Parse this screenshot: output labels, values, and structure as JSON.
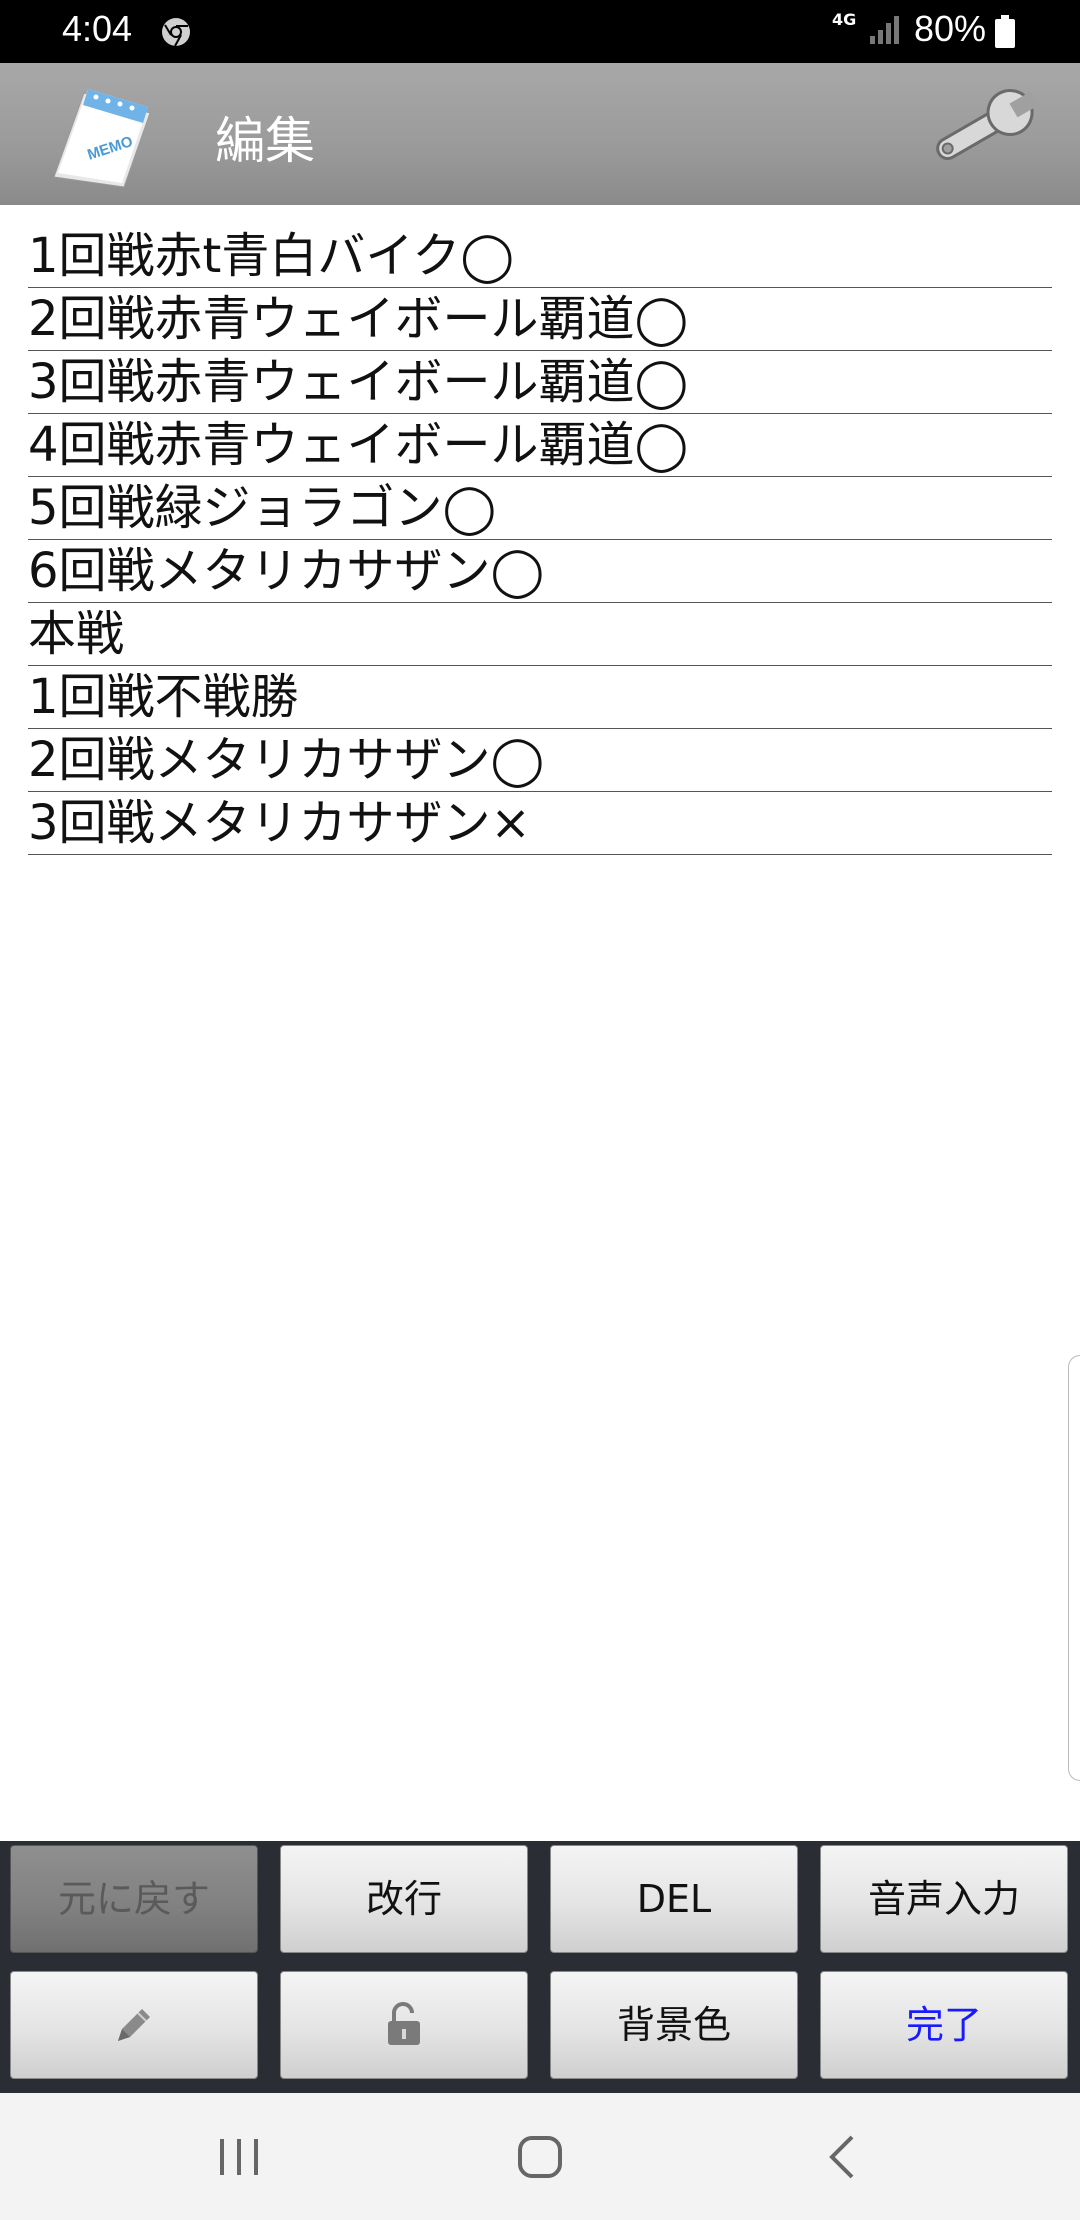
{
  "status_bar": {
    "time": "4:04",
    "network": "4G",
    "battery": "80%"
  },
  "app_bar": {
    "title": "編集",
    "icons": [
      "memo-pad-icon",
      "wrench-icon"
    ]
  },
  "memo": {
    "lines": [
      "1回戦赤t青白バイク◯",
      "2回戦赤青ウェイボール覇道◯",
      "3回戦赤青ウェイボール覇道◯",
      "4回戦赤青ウェイボール覇道◯",
      "5回戦緑ジョラゴン◯",
      "6回戦メタリカサザン◯",
      "本戦",
      "1回戦不戦勝",
      "2回戦メタリカサザン◯",
      "3回戦メタリカサザン×"
    ]
  },
  "buttons": {
    "undo": "元に戻す",
    "newline": "改行",
    "delete": "DEL",
    "voice_input": "音声入力",
    "background_color": "背景色",
    "done": "完了",
    "icons": [
      "pencil-icon",
      "lock-icon"
    ]
  },
  "colors": {
    "app_bar": "#9a9a9a",
    "button_panel": "#2a2d33",
    "done_text": "#1a1aff"
  }
}
